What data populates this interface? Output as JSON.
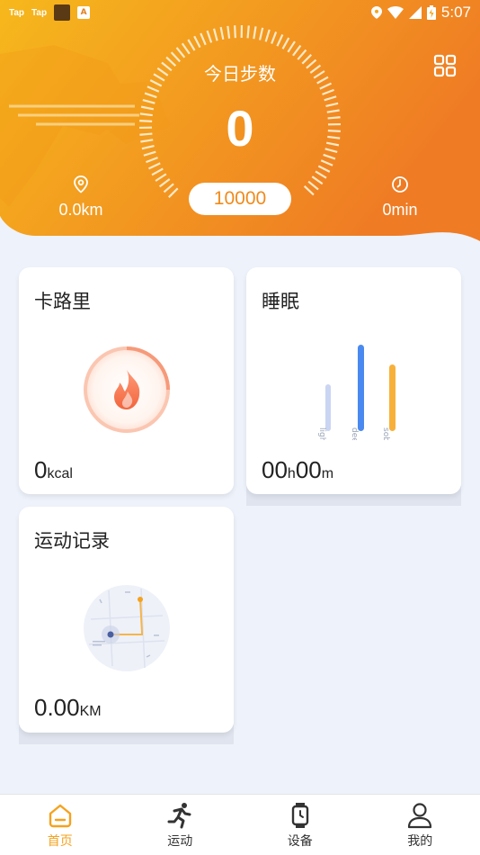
{
  "status_bar": {
    "app_tags": [
      "Tap",
      "Tap"
    ],
    "badge_letter": "A",
    "time": "5:07"
  },
  "header": {
    "title": "今日步数",
    "steps": "0",
    "goal": "10000",
    "distance": "0.0km",
    "duration": "0min"
  },
  "cards": {
    "calories": {
      "title": "卡路里",
      "value": "0",
      "unit": "kcal"
    },
    "sleep": {
      "title": "睡眠",
      "hours": "00",
      "hours_unit": "h",
      "minutes": "00",
      "minutes_unit": "m",
      "bar_labels": [
        "light",
        "deep",
        "sober"
      ]
    },
    "exercise": {
      "title": "运动记录",
      "value": "0.00",
      "unit": "KM"
    }
  },
  "nav": [
    {
      "label": "首页",
      "icon": "home-icon",
      "active": true
    },
    {
      "label": "运动",
      "icon": "running-icon",
      "active": false
    },
    {
      "label": "设备",
      "icon": "watch-icon",
      "active": false
    },
    {
      "label": "我的",
      "icon": "user-icon",
      "active": false
    }
  ],
  "colors": {
    "orange_light": "#f7b21d",
    "orange_dark": "#f07f22",
    "accent_blue": "#4a8af0",
    "nav_active": "#f5a21e"
  }
}
